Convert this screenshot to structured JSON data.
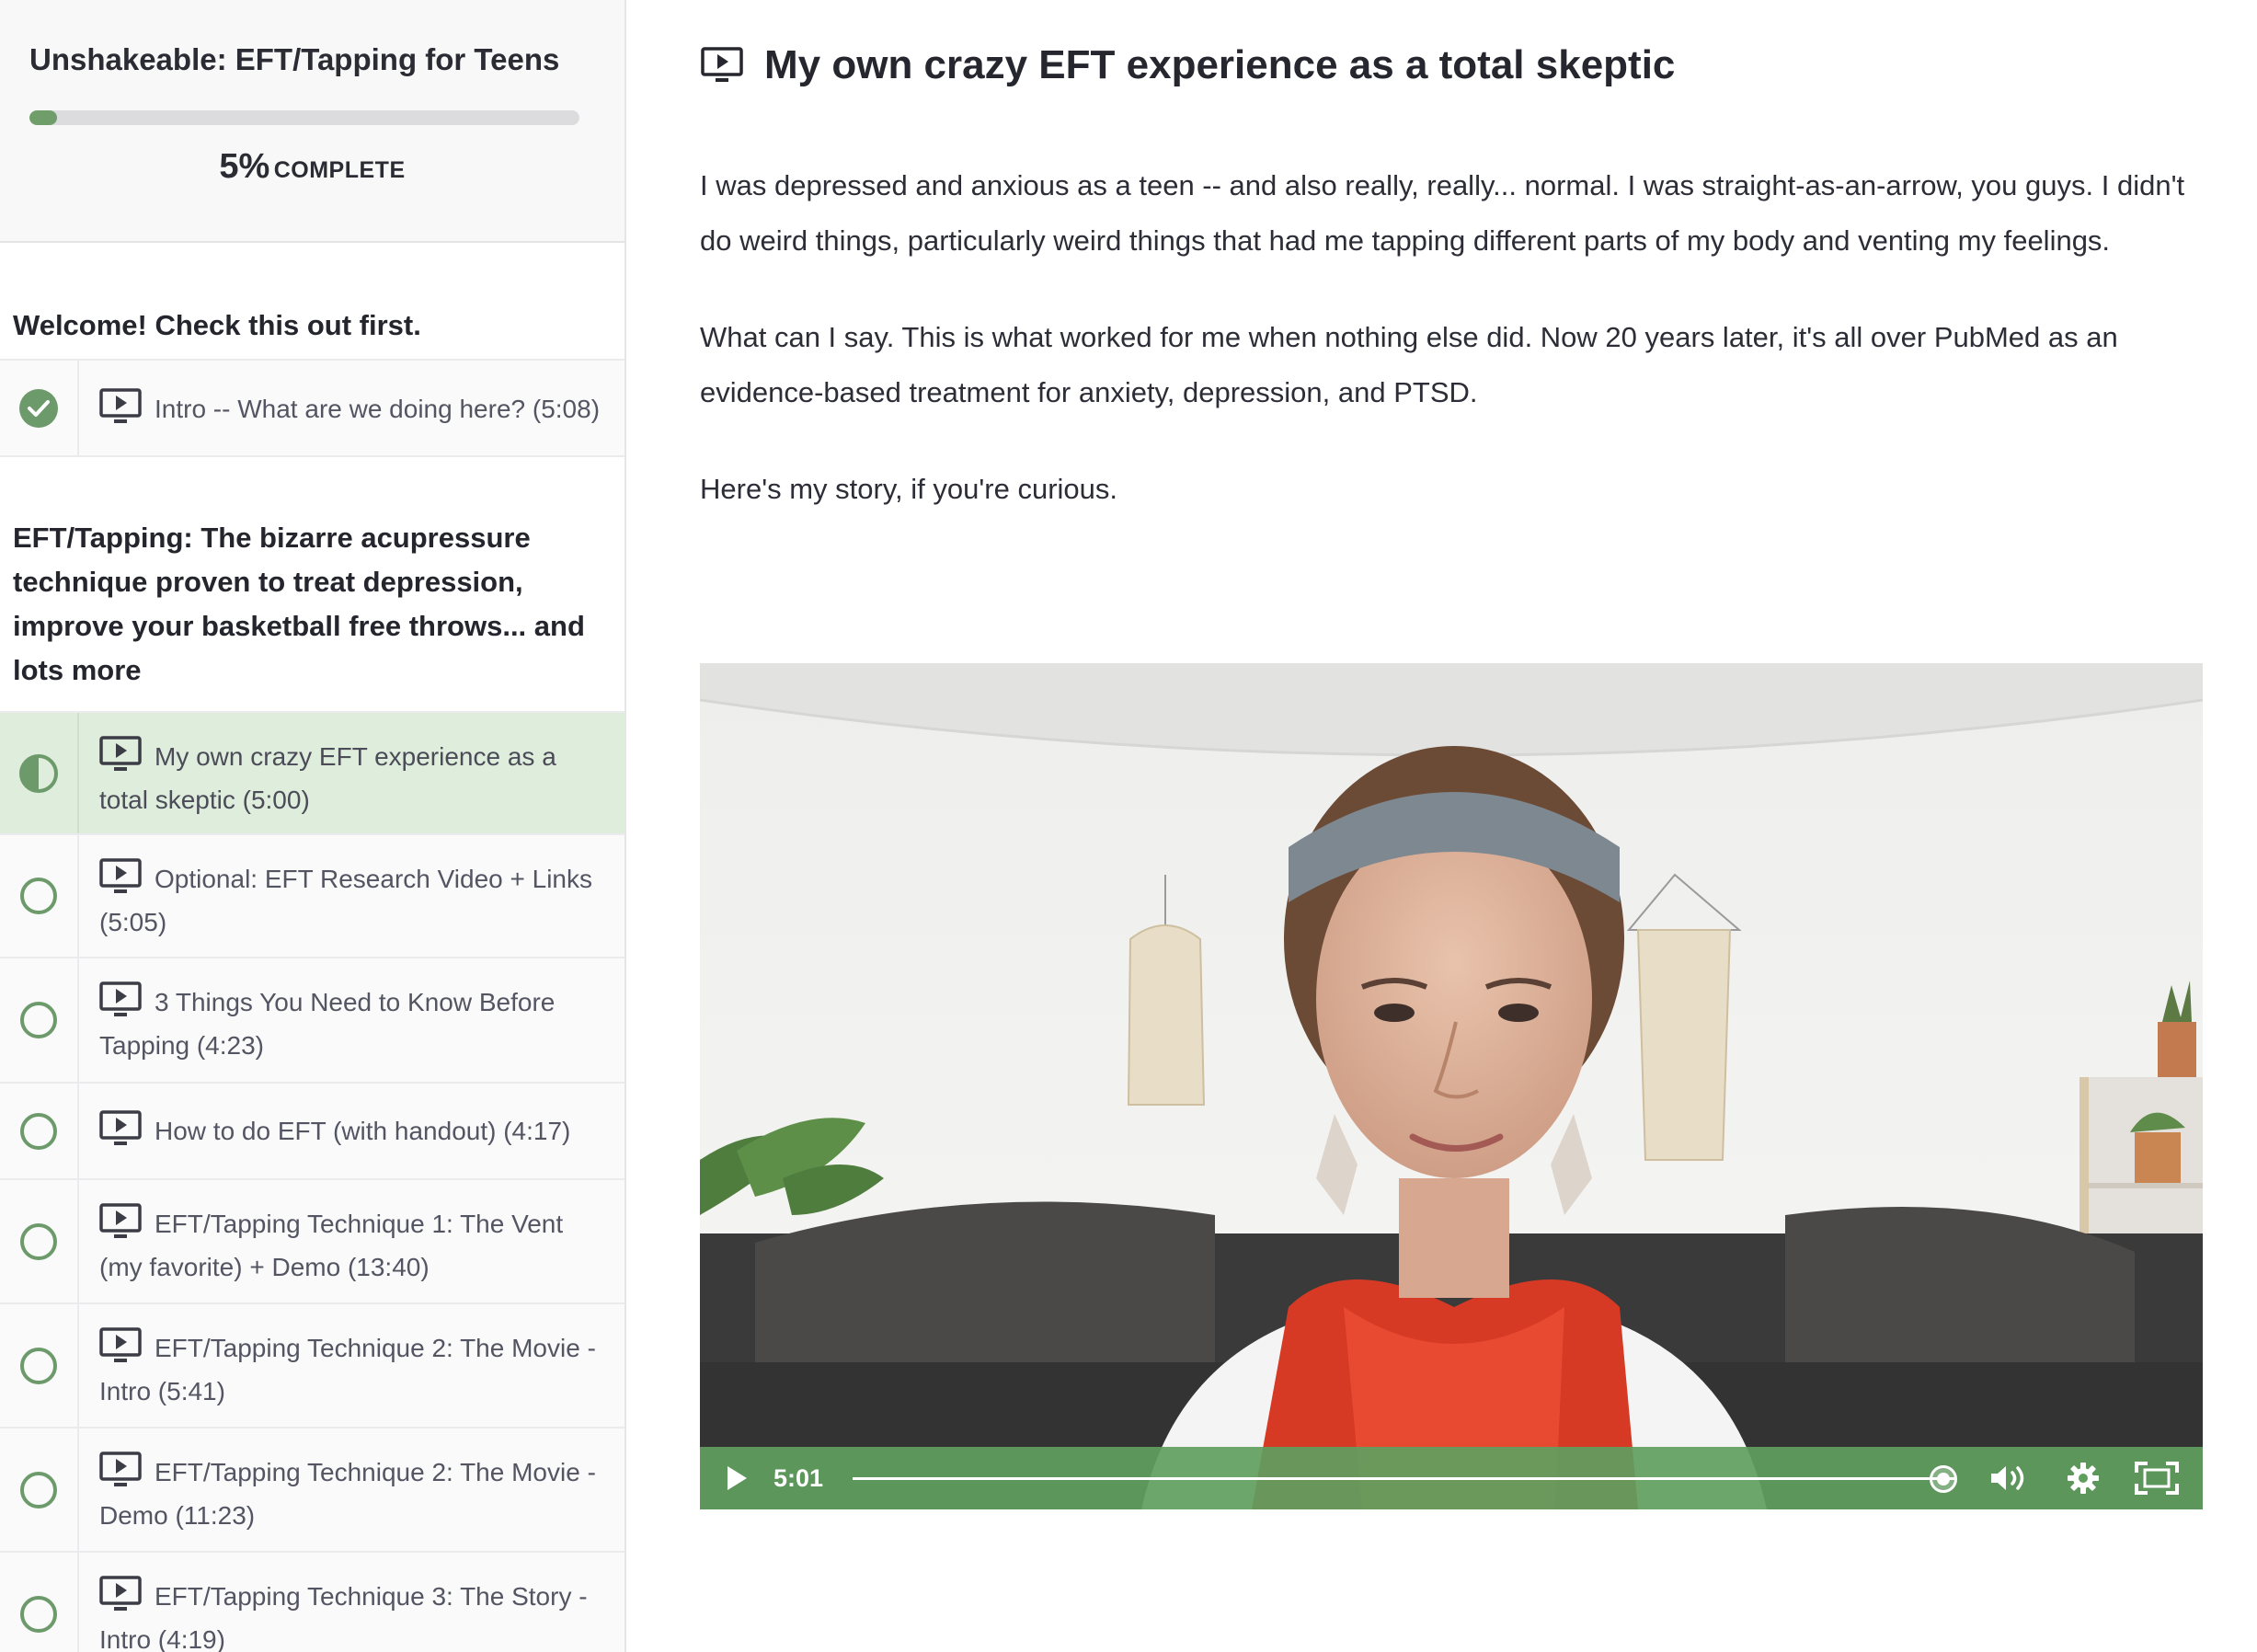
{
  "sidebar": {
    "course_title": "Unshakeable: EFT/Tapping for Teens",
    "progress": {
      "percent": 5,
      "percent_label": "5%",
      "complete_label": "COMPLETE"
    },
    "sections": [
      {
        "title": "Welcome! Check this out first.",
        "lessons": [
          {
            "title": "Intro -- What are we doing here? (5:08)",
            "status": "complete"
          }
        ]
      },
      {
        "title": "EFT/Tapping: The bizarre acupressure technique proven to treat depression, improve your basketball free throws... and lots more",
        "lessons": [
          {
            "title": "My own crazy EFT experience as a total skeptic (5:00)",
            "status": "in-progress"
          },
          {
            "title": "Optional: EFT Research Video + Links (5:05)",
            "status": "not-started"
          },
          {
            "title": "3 Things You Need to Know Before Tapping (4:23)",
            "status": "not-started"
          },
          {
            "title": "How to do EFT (with handout) (4:17)",
            "status": "not-started"
          },
          {
            "title": "EFT/Tapping Technique 1: The Vent (my favorite) + Demo (13:40)",
            "status": "not-started"
          },
          {
            "title": "EFT/Tapping Technique 2: The Movie - Intro (5:41)",
            "status": "not-started"
          },
          {
            "title": "EFT/Tapping Technique 2: The Movie - Demo (11:23)",
            "status": "not-started"
          },
          {
            "title": "EFT/Tapping Technique 3: The Story - Intro (4:19)",
            "status": "not-started"
          }
        ]
      }
    ]
  },
  "main": {
    "lesson_title": "My own crazy EFT experience as a total skeptic",
    "paragraphs": [
      "I was depressed and anxious as a teen -- and also really, really... normal. I was straight-as-an-arrow, you guys. I didn't do weird things, particularly weird things that had me tapping different parts of my body and venting my feelings.",
      "What can I say. This is what worked for me when nothing else did. Now 20 years later, it's all over PubMed as an evidence-based treatment for anxiety, depression, and PTSD.",
      "Here's my story, if you're curious."
    ],
    "video": {
      "time_label": "5:01",
      "played_fraction": 0.99,
      "controls": [
        "play-icon",
        "volume-icon",
        "settings-gear-icon",
        "fullscreen-icon"
      ]
    }
  },
  "colors": {
    "accent_green": "#6d9a6a",
    "active_lesson_bg": "#dfeddc",
    "video_controls_bg": "#609e5e"
  }
}
